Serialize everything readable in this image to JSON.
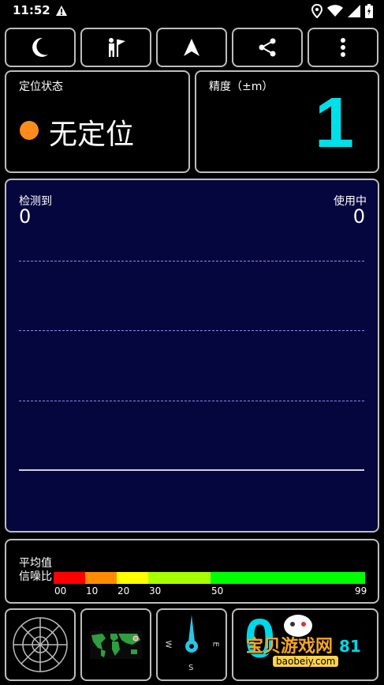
{
  "status_bar": {
    "time": "11:52"
  },
  "status_panel": {
    "label": "定位状态",
    "fix_status": "无定位",
    "indicator_color": "#ff8c1a"
  },
  "accuracy_panel": {
    "label": "精度（±m）",
    "value": "1",
    "value_color": "#00e0e8"
  },
  "signal_panel": {
    "detected_label": "检测到",
    "detected_count": "0",
    "used_label": "使用中",
    "used_count": "0"
  },
  "average_panel": {
    "label_line1": "平均值",
    "label_line2": "信噪比",
    "scale_ticks": [
      "00",
      "10",
      "20",
      "30",
      "50",
      "99"
    ],
    "scale_colors": [
      "#ff0000",
      "#ff8c00",
      "#ffff00",
      "#a8ff00",
      "#00ff00"
    ]
  },
  "watermark": {
    "title": "宝贝游戏网",
    "subtitle": "baobeiy.com",
    "number": "81"
  },
  "compass": {
    "west": "W",
    "east": "E",
    "south": "S"
  }
}
